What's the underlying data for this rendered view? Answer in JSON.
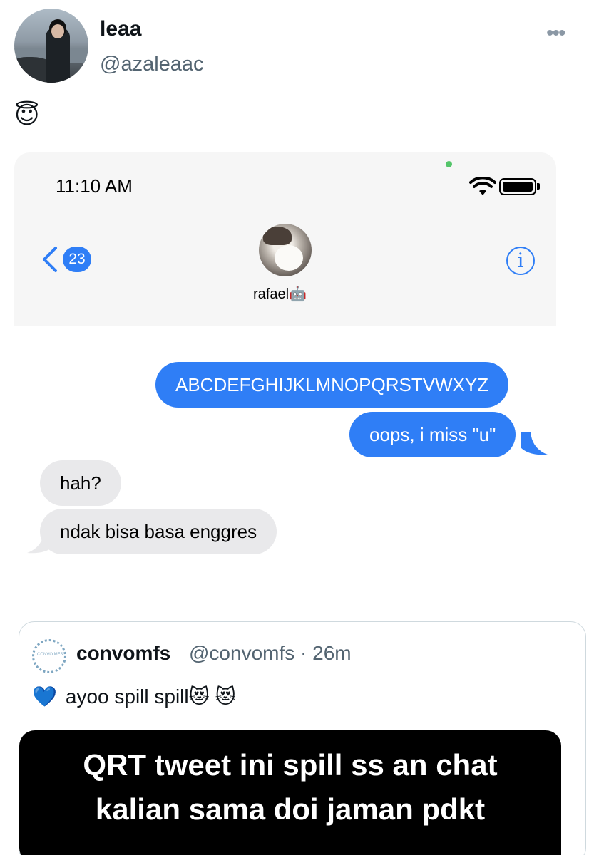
{
  "author": {
    "display_name": "leaa",
    "handle": "@azaleaac"
  },
  "more_label": "•••",
  "tweet_text": "😇",
  "screenshot": {
    "status_time": "11:10 AM",
    "unread_count": "23",
    "contact_name": "rafael🤖",
    "info_label": "i",
    "messages": [
      {
        "type": "sent",
        "text": "ABCDEFGHIJKLMNOPQRSTVWXYZ"
      },
      {
        "type": "sent",
        "text": "oops, i miss \"u\""
      },
      {
        "type": "received",
        "text": "hah?"
      },
      {
        "type": "received",
        "text": "ndak bisa basa enggres"
      }
    ]
  },
  "quoted": {
    "avatar_text": "CONVO MFS",
    "name": "convomfs",
    "meta": "@convomfs · 26m",
    "text": "ayoo spill spill😻 😻",
    "text_icon": "💙",
    "image_text": "QRT tweet ini spill ss an chat\nkalian sama doi jaman pdkt"
  },
  "colors": {
    "imessage_blue": "#2f7ef6",
    "received_gray": "#e9e9eb",
    "secondary_text": "#536471"
  }
}
